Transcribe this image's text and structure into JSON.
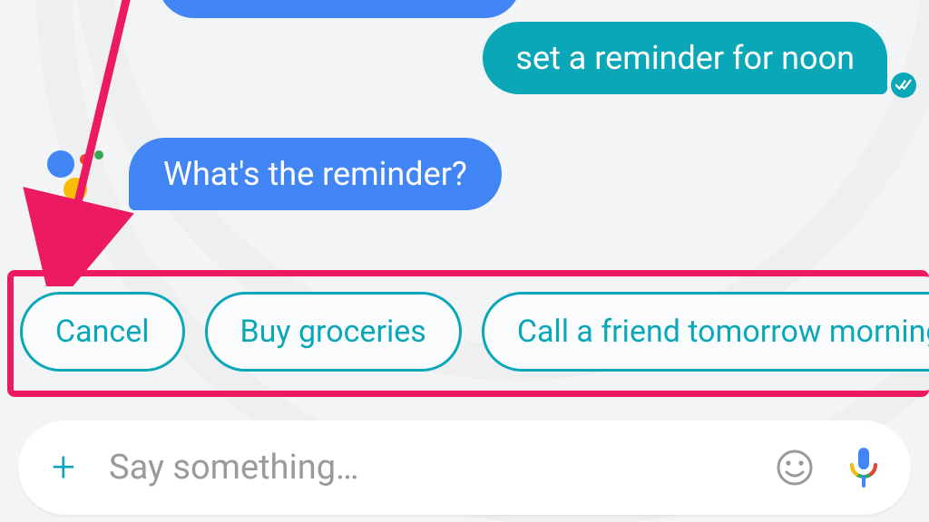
{
  "colors": {
    "teal": "#0aa7b8",
    "blue": "#4285F4",
    "highlight": "#ec1a63"
  },
  "messages": {
    "outgoing": "set a reminder for noon",
    "incoming": "What's the reminder?"
  },
  "chips": [
    "Cancel",
    "Buy groceries",
    "Call a friend tomorrow morning"
  ],
  "input": {
    "placeholder": "Say something…"
  },
  "icons": {
    "plus": "+",
    "emoji": "emoji-icon",
    "mic": "mic-icon",
    "receipt": "double-check-icon",
    "assistant": "assistant-logo"
  }
}
